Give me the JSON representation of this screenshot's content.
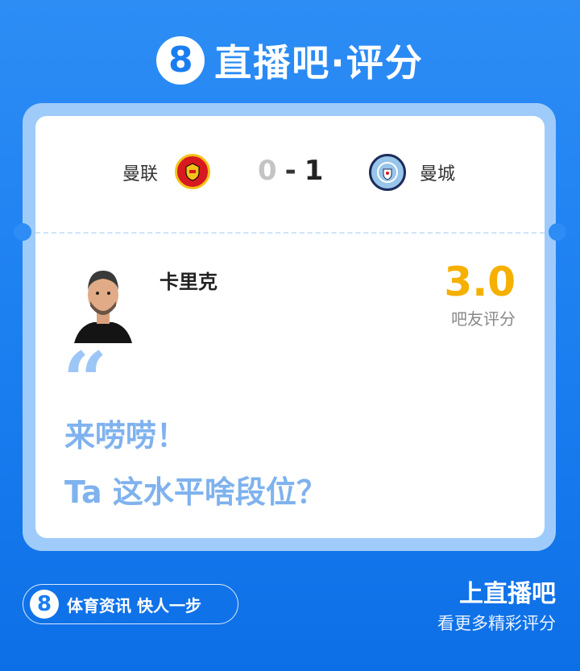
{
  "brand": {
    "logo_glyph": "8",
    "name": "直播吧·评分"
  },
  "match": {
    "home_team": "曼联",
    "home_logo_icon": "manchester-united-crest",
    "home_score": "0",
    "separator": "-",
    "away_score": "1",
    "away_team": "曼城",
    "away_logo_icon": "manchester-city-crest"
  },
  "player": {
    "name": "卡里克",
    "rating": "3.0",
    "rating_label": "吧友评分"
  },
  "quote": {
    "mark": "“",
    "line1": "来唠唠！",
    "line2": "Ta 这水平啥段位？"
  },
  "footer": {
    "logo_glyph": "8",
    "slogan": "体育资讯 快人一步",
    "cta_title": "上直播吧",
    "cta_subtitle": "看更多精彩评分"
  },
  "colors": {
    "background": "#1a7ef0",
    "rating": "#f5b000",
    "quote": "#7fb2ee",
    "card_border": "#9fcbfa"
  }
}
